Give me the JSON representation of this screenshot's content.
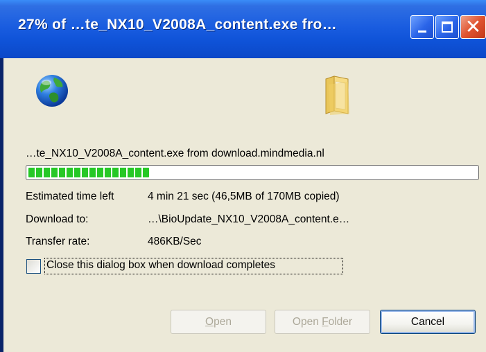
{
  "window": {
    "title": "27% of …te_NX10_V2008A_content.exe fro…",
    "controls": {
      "minimize_icon": "minimize-icon",
      "maximize_icon": "maximize-icon",
      "close_icon": "close-icon"
    }
  },
  "icons": {
    "source": "globe-icon",
    "destination": "folder-icon"
  },
  "download": {
    "file_line": "…te_NX10_V2008A_content.exe from download.mindmedia.nl",
    "progress_percent": 27,
    "estimated_label": "Estimated time left",
    "estimated_value": "4 min 21 sec (46,5MB of 170MB copied)",
    "download_to_label": "Download to:",
    "download_to_value": "…\\BioUpdate_NX10_V2008A_content.e…",
    "transfer_rate_label": "Transfer rate:",
    "transfer_rate_value": "486KB/Sec"
  },
  "options": {
    "close_when_done_label": "Close this dialog box when download completes",
    "close_when_done_checked": false
  },
  "buttons": {
    "open": {
      "mnemonic": "O",
      "rest": "pen"
    },
    "open_folder": {
      "prefix": "Open ",
      "mnemonic": "F",
      "rest": "older"
    },
    "cancel": "Cancel"
  },
  "colors": {
    "titlebar": "#0f53d8",
    "progress": "#26c826",
    "dialog_bg": "#ece9d8"
  }
}
